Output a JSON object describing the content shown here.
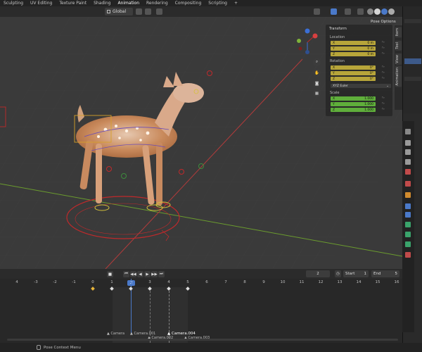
{
  "menubar": {
    "tabs": [
      "Sculpting",
      "UV Editing",
      "Texture Paint",
      "Shading",
      "Animation",
      "Rendering",
      "Compositing",
      "Scripting",
      "+"
    ]
  },
  "viewport_header": {
    "orientation": "Global"
  },
  "pose_options": "Pose Options",
  "npanel": {
    "title": "Transform",
    "location_label": "Location",
    "location": [
      {
        "axis": "X",
        "value": "0 m"
      },
      {
        "axis": "Y",
        "value": "0 m"
      },
      {
        "axis": "Z",
        "value": "0 m"
      }
    ],
    "rotation_label": "Rotation",
    "rotation": [
      {
        "axis": "X",
        "value": "0°"
      },
      {
        "axis": "Y",
        "value": "0°"
      },
      {
        "axis": "Z",
        "value": "0°"
      }
    ],
    "rotation_mode": "XYZ Euler",
    "scale_label": "Scale",
    "scale": [
      {
        "axis": "X",
        "value": "1.000"
      },
      {
        "axis": "Y",
        "value": "1.000"
      },
      {
        "axis": "Z",
        "value": "1.000"
      }
    ]
  },
  "side_tabs": [
    "Item",
    "Tool",
    "View",
    "Animation"
  ],
  "timeline": {
    "current_frame": "2",
    "start_label": "Start",
    "start": "1",
    "end_label": "End",
    "end": "5",
    "ruler": [
      "4",
      "-3",
      "-2",
      "-1",
      "0",
      "1",
      "2",
      "3",
      "4",
      "5",
      "6",
      "7",
      "8",
      "9",
      "10",
      "11",
      "12",
      "13",
      "14",
      "15",
      "16"
    ],
    "markers": [
      "Camera",
      "Camera.001",
      "Camera.002",
      "Camera.003",
      "Camera.004"
    ]
  },
  "statusbar": {
    "text": "Pose Context Menu"
  },
  "colors": {
    "location_field": "#b7a53a",
    "scale_field": "#5fae3b",
    "playhead": "#4a79c9",
    "axis_x": "#b33b3b",
    "axis_y": "#6b9c2e"
  }
}
